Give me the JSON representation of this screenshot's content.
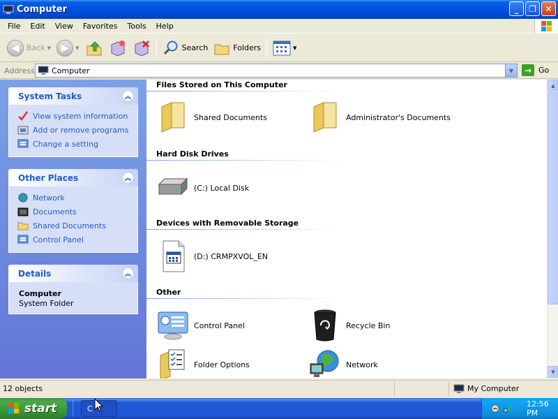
{
  "window": {
    "title": "Computer"
  },
  "menubar": [
    "File",
    "Edit",
    "View",
    "Favorites",
    "Tools",
    "Help"
  ],
  "toolbar": {
    "back": "Back",
    "search": "Search",
    "folders": "Folders"
  },
  "address": {
    "label": "Address",
    "value": "Computer",
    "go": "Go"
  },
  "tasks": {
    "system": {
      "title": "System Tasks",
      "items": [
        "View system information",
        "Add or remove programs",
        "Change a setting"
      ]
    },
    "places": {
      "title": "Other Places",
      "items": [
        "Network",
        "Documents",
        "Shared Documents",
        "Control Panel"
      ]
    },
    "details": {
      "title": "Details",
      "name": "Computer",
      "type": "System Folder"
    }
  },
  "groups": [
    {
      "title": "Files Stored on This Computer",
      "items": [
        "Shared Documents",
        "Administrator's Documents"
      ]
    },
    {
      "title": "Hard Disk Drives",
      "items": [
        "(C:) Local Disk"
      ]
    },
    {
      "title": "Devices with Removable Storage",
      "items": [
        "(D:) CRMPXVOL_EN"
      ]
    },
    {
      "title": "Other",
      "items": [
        "Control Panel",
        "Recycle Bin",
        "Folder Options",
        "Network"
      ]
    }
  ],
  "status": {
    "count": "12 objects",
    "location": "My Computer"
  },
  "taskbar": {
    "start": "start",
    "task": "C",
    "clock": "12:56 PM"
  },
  "icons": {
    "folder": "folder-icon",
    "drive": "hard-disk-icon",
    "cd": "cd-drive-icon",
    "control_panel": "control-panel-icon",
    "recycle": "recycle-bin-icon",
    "folder_options": "folder-options-icon",
    "network": "network-icon"
  },
  "colors": {
    "title_bar": "#0054e3",
    "task_link": "#215dc6",
    "start_green": "#379a35",
    "pane_gradient_top": "#7ba2e7"
  }
}
